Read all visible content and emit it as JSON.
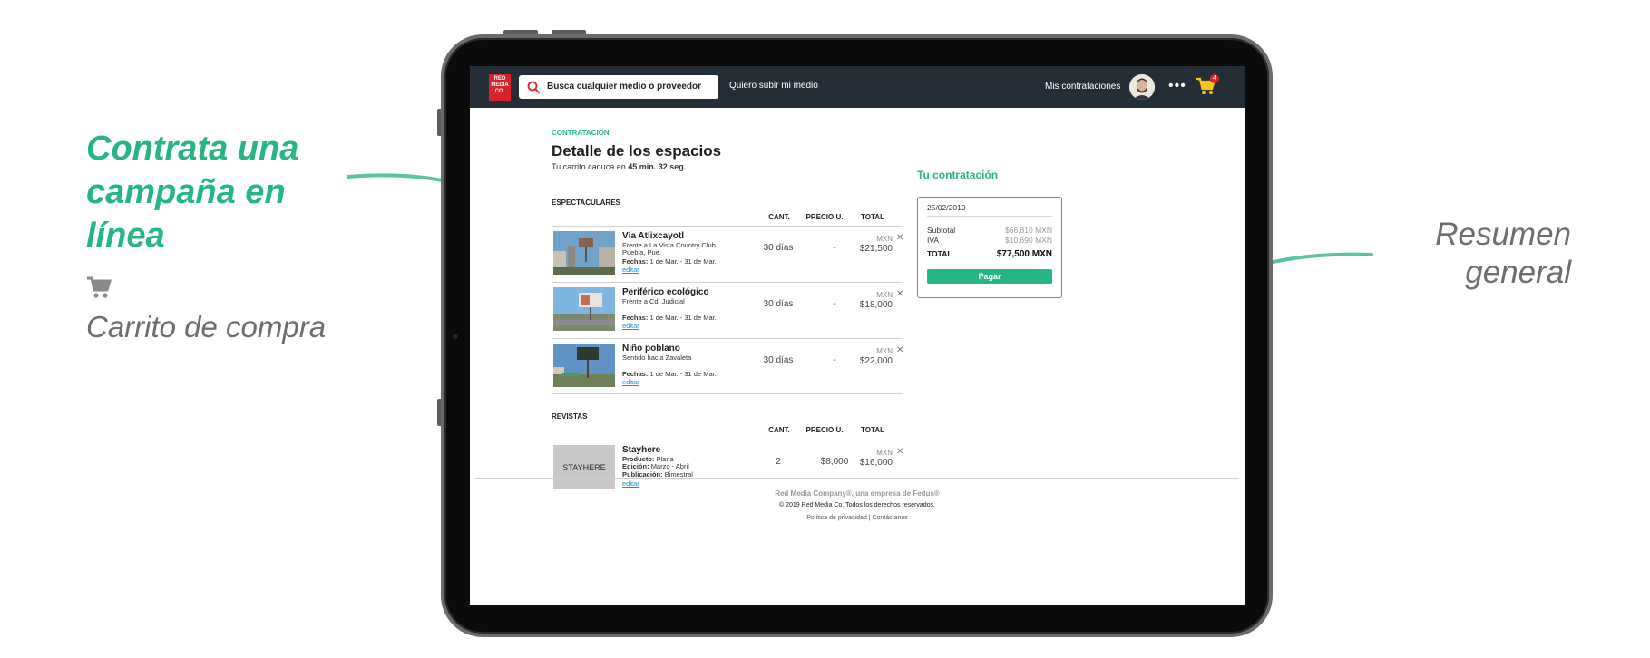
{
  "annotations": {
    "left_title": "Contrata una campaña en línea",
    "left_subtitle": "Carrito de compra",
    "right_label": "Resumen general"
  },
  "colors": {
    "accent": "#27b584",
    "brand_red": "#d8232a",
    "nav_bg": "#252e36",
    "link": "#1a8fd6"
  },
  "nav": {
    "logo": "RED MEDIA CO.",
    "search_placeholder": "Busca cualquier medio o proveedor",
    "upload_link": "Quiero subir mi medio",
    "my_contracts": "Mis contrataciones",
    "more": "•••",
    "cart_count": "4",
    "icons": [
      "search-icon",
      "avatar",
      "more-icon",
      "cart-icon"
    ]
  },
  "page": {
    "eyebrow": "CONTRATACION",
    "title": "Detalle de los espacios",
    "expire_prefix": "Tu carrito caduca en",
    "expire_time": "45 min. 32 seg."
  },
  "espectaculares": {
    "section": "ESPECTACULARES",
    "col_qty": "CANT.",
    "col_unit": "PRECIO U.",
    "col_total": "TOTAL",
    "items": [
      {
        "title": "Vía Atlixcayotl",
        "line1": "Frente a La Vista Country Club",
        "line2": "Puebla, Pue.",
        "date_label": "Fechas:",
        "dates": "1 de Mar. - 31 de Mar.",
        "edit": "editar",
        "qty": "30 días",
        "unit_price": "-",
        "currency": "MXN",
        "total": "$21,500"
      },
      {
        "title": "Periférico ecológico",
        "line1": "Frente a Cd. Judicial",
        "line2": "",
        "date_label": "Fechas:",
        "dates": "1 de Mar. - 31 de Mar.",
        "edit": "editar",
        "qty": "30 días",
        "unit_price": "-",
        "currency": "MXN",
        "total": "$18,000"
      },
      {
        "title": "Niño poblano",
        "line1": "Sentido hacia Zavaleta",
        "line2": "",
        "date_label": "Fechas:",
        "dates": "1 de Mar. - 31 de Mar.",
        "edit": "editar",
        "qty": "30 días",
        "unit_price": "-",
        "currency": "MXN",
        "total": "$22,000"
      }
    ]
  },
  "revistas": {
    "section": "REVISTAS",
    "col_qty": "CANT.",
    "col_unit": "PRECIO U.",
    "col_total": "TOTAL",
    "items": [
      {
        "title": "Stayhere",
        "thumb_text": "STAYHERE",
        "product_label": "Producto:",
        "product": "Plana",
        "edition_label": "Edición:",
        "edition": "Marzo - Abril",
        "publication_label": "Publicación:",
        "publication": "Bimestral",
        "edit": "editar",
        "qty": "2",
        "unit_price": "$8,000",
        "currency": "MXN",
        "total": "$16,000"
      }
    ]
  },
  "summary": {
    "title": "Tu contratación",
    "date": "25/02/2019",
    "subtotal_label": "Subtotal",
    "subtotal": "$66,810 MXN",
    "iva_label": "IVA",
    "iva": "$10,690 MXN",
    "total_label": "TOTAL",
    "total": "$77,500 MXN",
    "pay_button": "Pagar"
  },
  "footer": {
    "company": "Red Media Company®, una empresa de Fedus®",
    "copyright": "© 2019 Red Media Co. Todos los derechos reservados.",
    "links": "Política de privacidad  |  Contáctanos"
  }
}
